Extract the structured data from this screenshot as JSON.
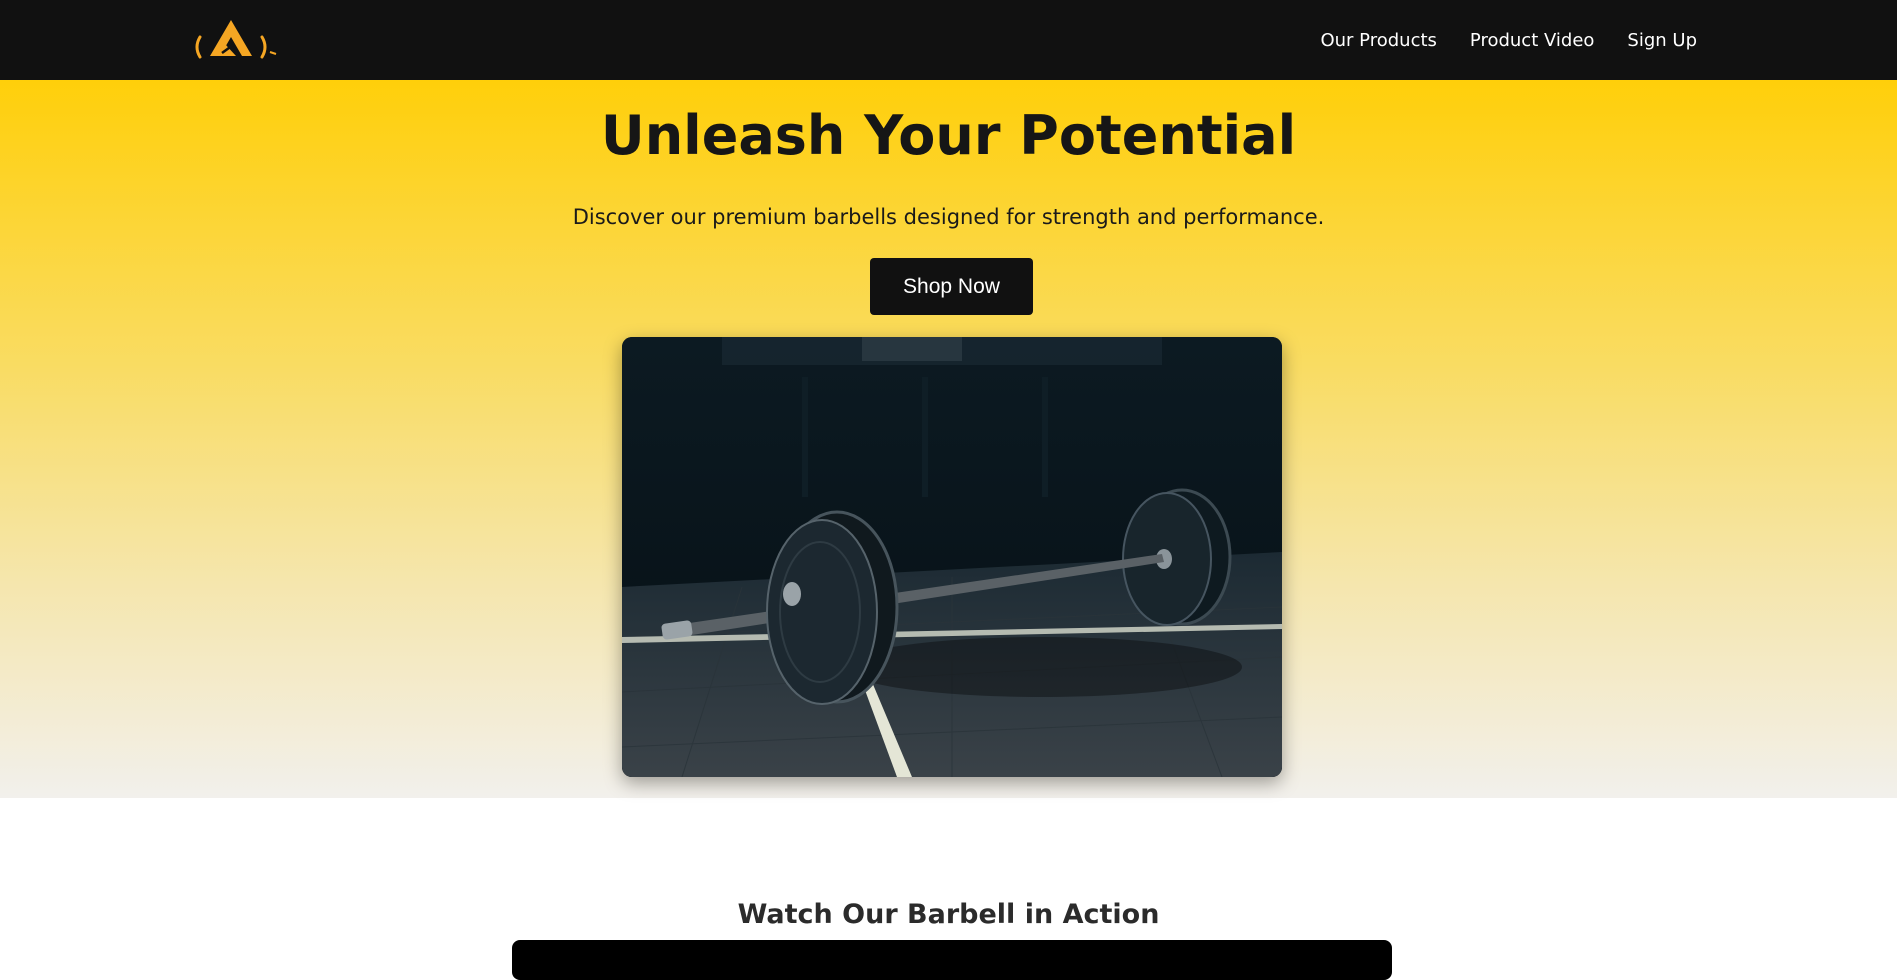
{
  "nav": {
    "logo_icon": "mountain-logo-icon",
    "links": [
      "Our Products",
      "Product Video",
      "Sign Up"
    ]
  },
  "hero": {
    "title": "Unleash Your Potential",
    "subtitle": "Discover our premium barbells designed for strength and performance.",
    "cta_label": "Shop Now",
    "image_icon": "barbell-photo"
  },
  "video_section": {
    "heading": "Watch Our Barbell in Action"
  },
  "colors": {
    "nav_bg": "#111111",
    "accent_yellow": "#ffcf0a",
    "logo_orange": "#f5a623"
  }
}
